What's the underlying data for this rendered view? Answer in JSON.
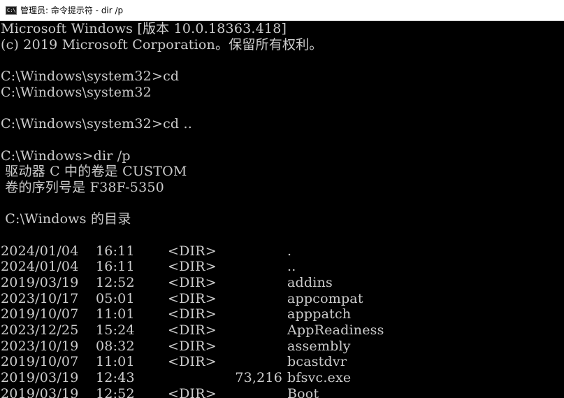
{
  "window": {
    "title": "管理员: 命令提示符 - dir  /p",
    "icon": "cmd-icon"
  },
  "colors": {
    "console_bg": "#000000",
    "console_fg": "#cccccc",
    "titlebar_bg": "#ffffff"
  },
  "console": {
    "header_lines": [
      "Microsoft Windows [版本 10.0.18363.418]",
      "(c) 2019 Microsoft Corporation。保留所有权利。",
      "",
      "C:\\Windows\\system32>cd",
      "C:\\Windows\\system32",
      "",
      "C:\\Windows\\system32>cd ..",
      "",
      "C:\\Windows>dir /p",
      " 驱动器 C 中的卷是 CUSTOM",
      " 卷的序列号是 F38F-5350",
      "",
      " C:\\Windows 的目录",
      ""
    ],
    "entries": [
      {
        "date": "2024/01/04",
        "time": "16:11",
        "type": "<DIR>",
        "size": "",
        "name": "."
      },
      {
        "date": "2024/01/04",
        "time": "16:11",
        "type": "<DIR>",
        "size": "",
        "name": ".."
      },
      {
        "date": "2019/03/19",
        "time": "12:52",
        "type": "<DIR>",
        "size": "",
        "name": "addins"
      },
      {
        "date": "2023/10/17",
        "time": "05:01",
        "type": "<DIR>",
        "size": "",
        "name": "appcompat"
      },
      {
        "date": "2019/10/07",
        "time": "11:01",
        "type": "<DIR>",
        "size": "",
        "name": "apppatch"
      },
      {
        "date": "2023/12/25",
        "time": "15:24",
        "type": "<DIR>",
        "size": "",
        "name": "AppReadiness"
      },
      {
        "date": "2023/10/19",
        "time": "08:32",
        "type": "<DIR>",
        "size": "",
        "name": "assembly"
      },
      {
        "date": "2019/10/07",
        "time": "11:01",
        "type": "<DIR>",
        "size": "",
        "name": "bcastdvr"
      },
      {
        "date": "2019/03/19",
        "time": "12:43",
        "type": "",
        "size": "73,216",
        "name": "bfsvc.exe"
      },
      {
        "date": "2019/03/19",
        "time": "12:52",
        "type": "<DIR>",
        "size": "",
        "name": "Boot"
      }
    ]
  }
}
